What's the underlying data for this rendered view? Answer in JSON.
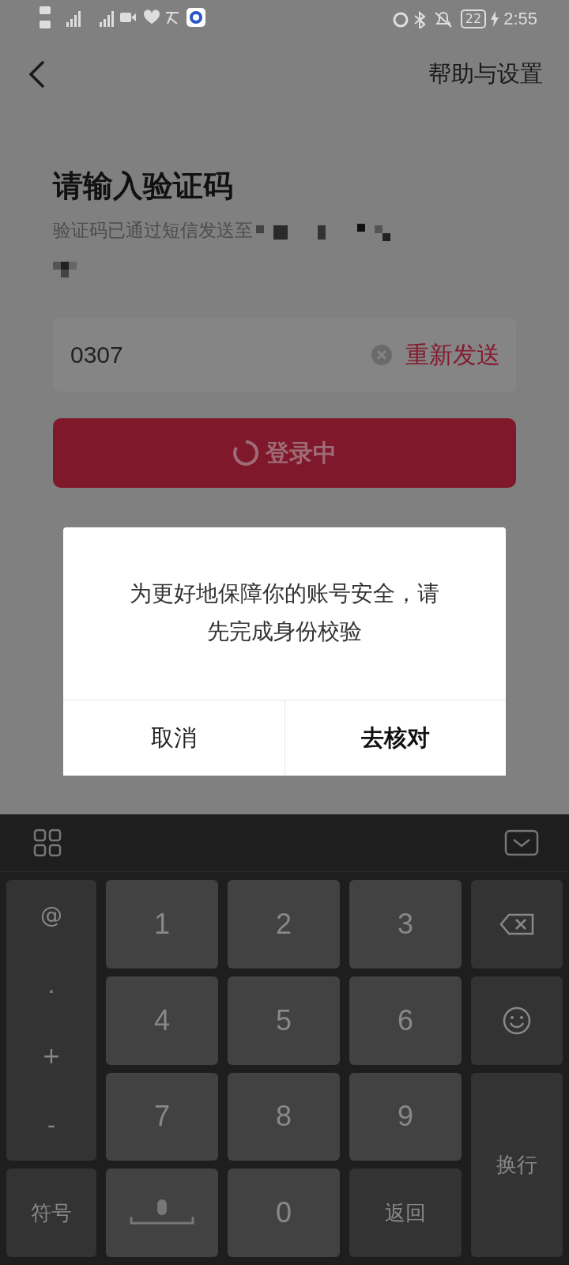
{
  "status_bar": {
    "battery": "22",
    "time": "2:55"
  },
  "header": {
    "help_link": "帮助与设置"
  },
  "title": "请输入验证码",
  "subtitle": "验证码已通过短信发送至",
  "code_field": {
    "value": "0307"
  },
  "resend_button": "重新发送",
  "login_button": {
    "label": "登录中",
    "loading": true
  },
  "dialog": {
    "message": "为更好地保障你的账号安全，请先完成身份校验",
    "buttons": [
      {
        "label": "取消",
        "primary": false
      },
      {
        "label": "去核对",
        "primary": true
      }
    ]
  },
  "keyboard": {
    "keys": [
      {
        "kind": "symbols",
        "symbols": [
          "@",
          ".",
          "+",
          "-"
        ]
      },
      {
        "kind": "digit",
        "label": "1"
      },
      {
        "kind": "digit",
        "label": "2"
      },
      {
        "kind": "digit",
        "label": "3"
      },
      {
        "kind": "backspace"
      },
      {
        "kind": "digit",
        "label": "4"
      },
      {
        "kind": "digit",
        "label": "5"
      },
      {
        "kind": "digit",
        "label": "6"
      },
      {
        "kind": "emoji"
      },
      {
        "kind": "digit",
        "label": "7"
      },
      {
        "kind": "digit",
        "label": "8"
      },
      {
        "kind": "digit",
        "label": "9"
      },
      {
        "kind": "enter",
        "label": "换行"
      },
      {
        "kind": "text",
        "label": "符号"
      },
      {
        "kind": "space"
      },
      {
        "kind": "digit",
        "label": "0"
      },
      {
        "kind": "text",
        "label": "返回"
      }
    ]
  }
}
